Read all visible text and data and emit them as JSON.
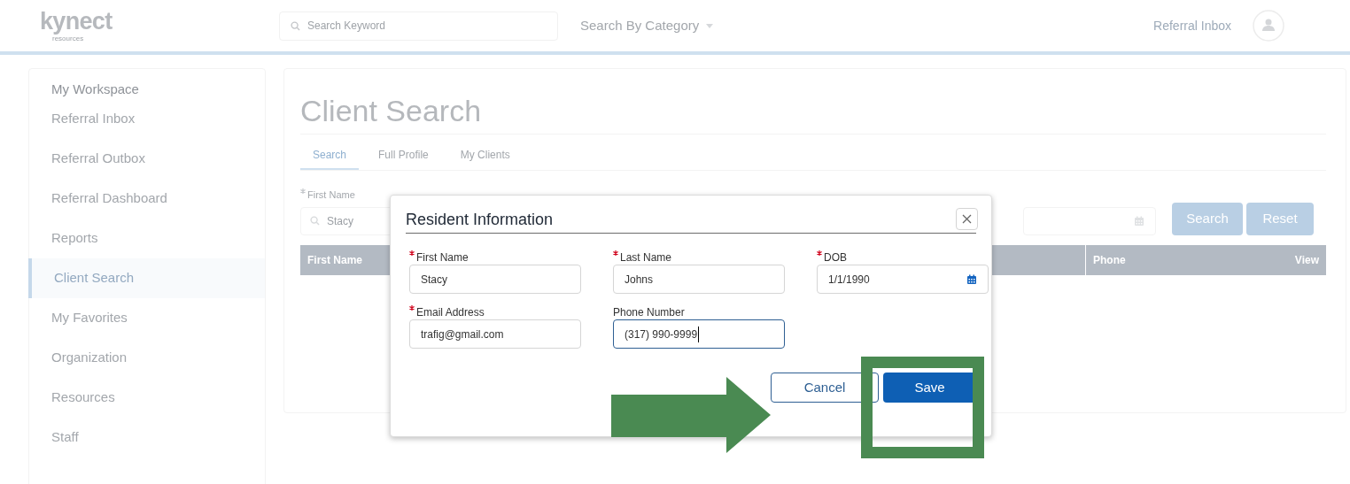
{
  "header": {
    "logo": "kynect",
    "logo_subtitle": "resources",
    "search": {
      "placeholder": "Search Keyword"
    },
    "category_menu": "Search By Category",
    "inbox_link": "Referral Inbox"
  },
  "sidebar": {
    "title": "My Workspace",
    "items": [
      {
        "label": "Referral Inbox",
        "selected": false
      },
      {
        "label": "Referral Outbox",
        "selected": false
      },
      {
        "label": "Referral Dashboard",
        "selected": false
      },
      {
        "label": "Reports",
        "selected": false
      },
      {
        "label": "Client Search",
        "selected": true
      },
      {
        "label": "My Favorites",
        "selected": false
      },
      {
        "label": "Organization",
        "selected": false
      },
      {
        "label": "Resources",
        "selected": false
      },
      {
        "label": "Staff",
        "selected": false
      }
    ]
  },
  "page": {
    "title": "Client Search",
    "tabs": [
      {
        "label": "Search",
        "selected": true
      },
      {
        "label": "Full Profile",
        "selected": false
      },
      {
        "label": "My Clients",
        "selected": false
      }
    ],
    "first_name": {
      "label": "First Name",
      "required": true,
      "value": "Stacy"
    },
    "buttons": [
      "Search",
      "Reset"
    ],
    "table": {
      "columns": [
        "First Name",
        "Phone",
        "View"
      ]
    }
  },
  "dialog": {
    "title": "Resident Information",
    "fields": [
      {
        "label": "First Name",
        "required": true,
        "value": "Stacy",
        "kind": "text",
        "focused": false
      },
      {
        "label": "Last Name",
        "required": true,
        "value": "Johns",
        "kind": "text",
        "focused": false
      },
      {
        "label": "DOB",
        "required": true,
        "value": "1/1/1990",
        "kind": "date",
        "focused": false
      },
      {
        "label": "Email Address",
        "required": true,
        "value": "trafig@gmail.com",
        "kind": "text",
        "focused": false
      },
      {
        "label": "Phone Number",
        "required": false,
        "value": "(317) 990-9999",
        "kind": "text",
        "focused": true
      }
    ],
    "buttons": [
      {
        "label": "Cancel",
        "kind": "secondary"
      },
      {
        "label": "Save",
        "kind": "primary"
      }
    ]
  }
}
